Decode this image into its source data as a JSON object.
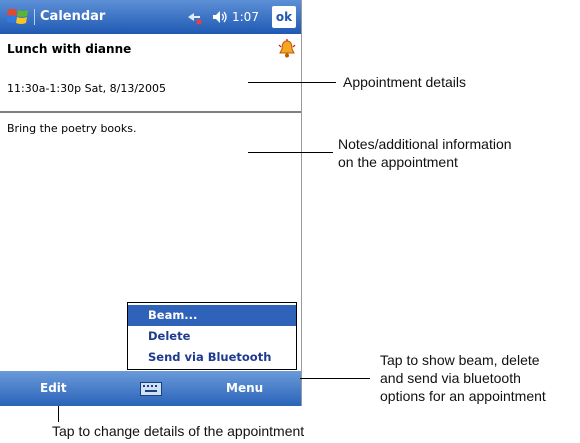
{
  "app": {
    "title": "Calendar",
    "time": "1:07",
    "ok_label": "ok"
  },
  "appointment": {
    "subject": "Lunch with dianne",
    "when": "11:30a-1:30p Sat, 8/13/2005",
    "notes": "Bring the poetry books."
  },
  "popup_menu": {
    "items": [
      "Beam...",
      "Delete",
      "Send via Bluetooth"
    ],
    "selected_index": 0
  },
  "command_bar": {
    "left_label": "Edit",
    "right_label": "Menu"
  },
  "callouts": {
    "details": "Appointment details",
    "notes_line1": "Notes/additional information",
    "notes_line2": "on the appointment",
    "menu_line1": "Tap to show beam, delete",
    "menu_line2": "and send via bluetooth",
    "menu_line3": "options for an appointment",
    "edit": "Tap to change details of the appointment"
  },
  "colors": {
    "bar_blue": "#2a63b8",
    "selection_blue": "#2f63b9"
  }
}
